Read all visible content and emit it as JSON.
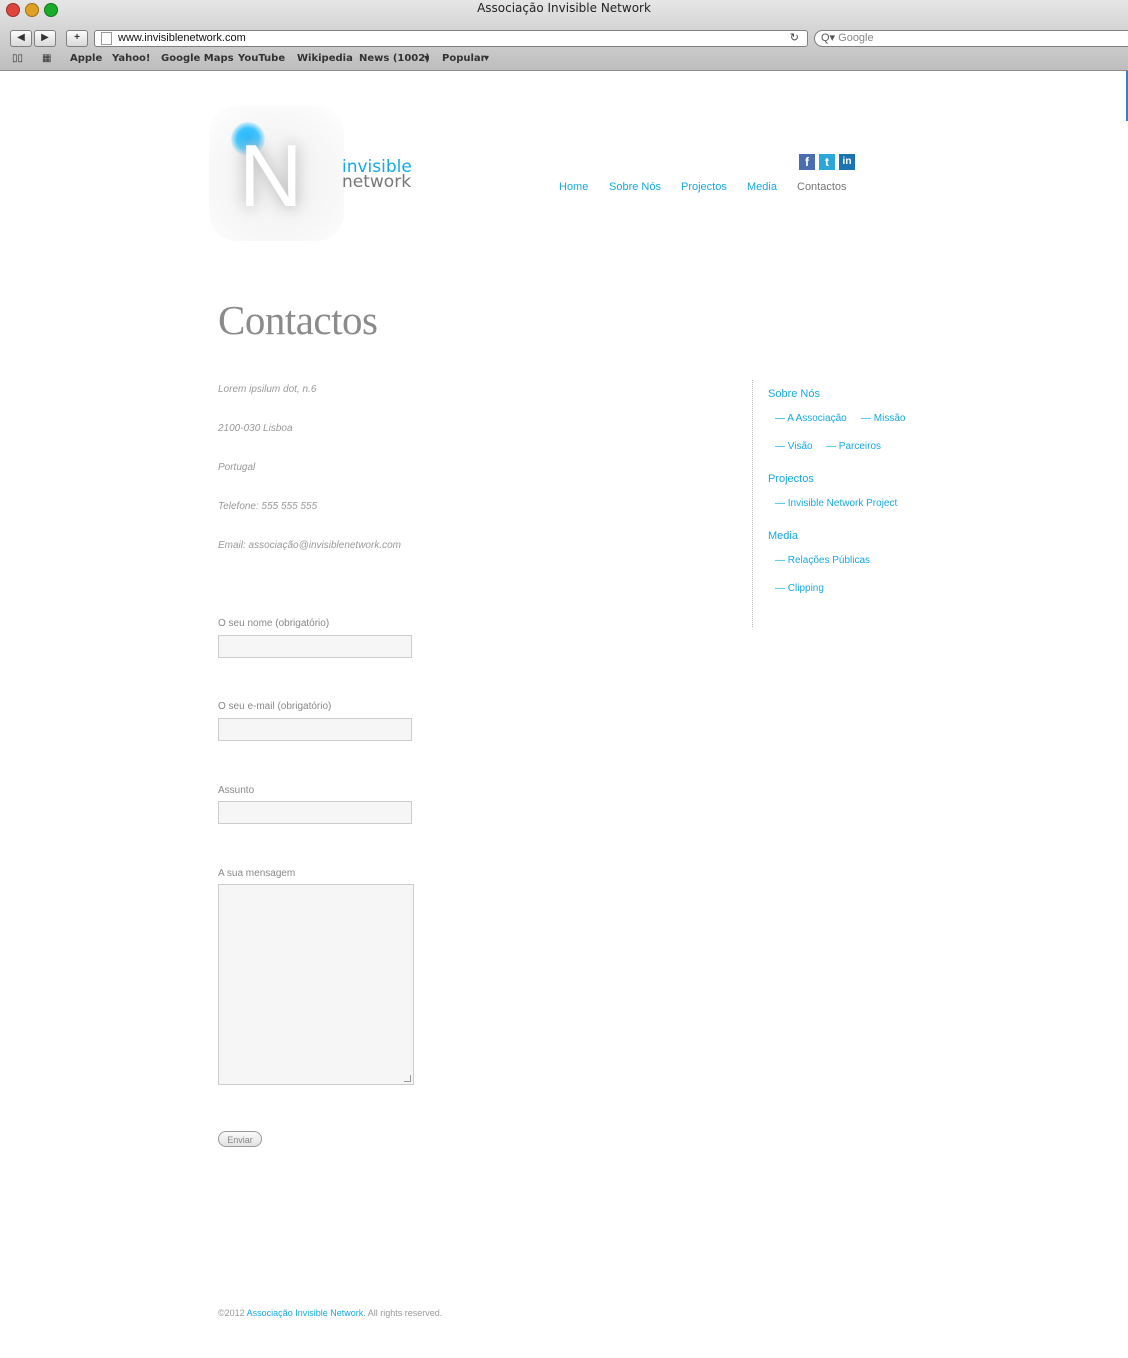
{
  "browser": {
    "window_title": "Associação Invisible Network",
    "url": "www.invisiblenetwork.com",
    "search_placeholder": "Google",
    "bookmarks": [
      "Apple",
      "Yahoo!",
      "Google Maps",
      "YouTube",
      "Wikipedia",
      "News (1002)",
      "Popular"
    ]
  },
  "site": {
    "brand_line1": "invisible",
    "brand_line2": "network",
    "logo_letter": "N",
    "nav": [
      "Home",
      "Sobre Nós",
      "Projectos",
      "Media",
      "Contactos"
    ],
    "social": {
      "facebook": "f",
      "twitter": "t",
      "linkedin": "in"
    }
  },
  "page": {
    "title": "Contactos",
    "address": [
      "Lorem ipsilum dot, n.6",
      "2100-030 Lisboa",
      "Portugal",
      "Telefone: 555 555 555",
      "Email: associação@invisiblenetwork.com"
    ],
    "form": {
      "name_label": "O seu nome (obrigatório)",
      "email_label": "O seu e-mail (obrigatório)",
      "subject_label": "Assunto",
      "message_label": "A sua mensagem",
      "submit_label": "Enviar"
    }
  },
  "sidebar": {
    "sobre_title": "Sobre Nós",
    "sobre_links": [
      "— A Associação",
      "— Missão",
      "— Visão",
      "— Parceiros"
    ],
    "projectos_title": "Projectos",
    "projectos_links": [
      "— Invisible Network Project"
    ],
    "media_title": "Media",
    "media_links": [
      "— Relações Públicas",
      "— Clipping"
    ]
  },
  "footer": {
    "prefix": "©2012 ",
    "link": "Associação Invisible Network",
    "suffix": ". All rights reserved."
  },
  "colors": {
    "accent": "#14a9e6",
    "muted": "#999999"
  }
}
